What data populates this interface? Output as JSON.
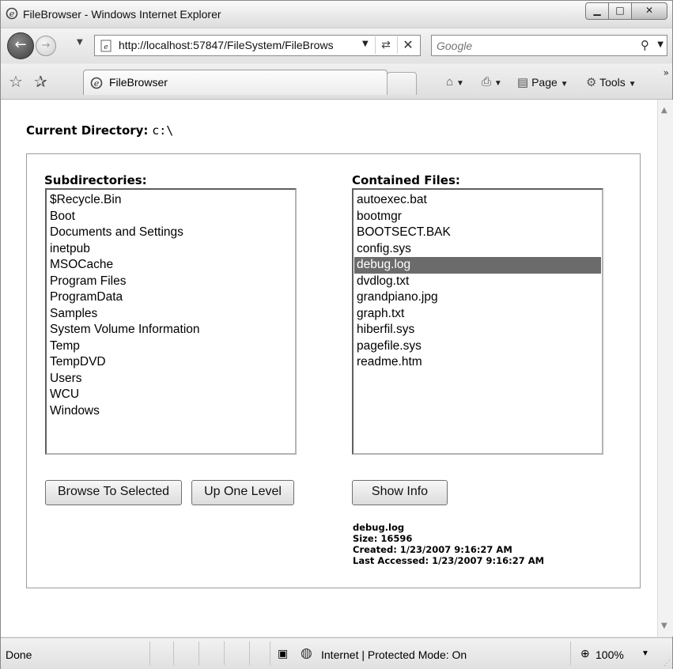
{
  "window": {
    "title": "FileBrowser - Windows Internet Explorer"
  },
  "address_bar": {
    "url": "http://localhost:57847/FileSystem/FileBrows"
  },
  "search": {
    "placeholder": "Google"
  },
  "tab": {
    "label": "FileBrowser"
  },
  "command_bar": {
    "page_label": "Page",
    "tools_label": "Tools"
  },
  "page": {
    "current_dir_label": "Current Directory:",
    "current_dir_value": "c:\\",
    "subdirs_label": "Subdirectories:",
    "files_label": "Contained Files:",
    "subdirectories": [
      "$Recycle.Bin",
      "Boot",
      "Documents and Settings",
      "inetpub",
      "MSOCache",
      "Program Files",
      "ProgramData",
      "Samples",
      "System Volume Information",
      "Temp",
      "TempDVD",
      "Users",
      "WCU",
      "Windows"
    ],
    "files": [
      "autoexec.bat",
      "bootmgr",
      "BOOTSECT.BAK",
      "config.sys",
      "debug.log",
      "dvdlog.txt",
      "grandpiano.jpg",
      "graph.txt",
      "hiberfil.sys",
      "pagefile.sys",
      "readme.htm"
    ],
    "selected_file_index": 4,
    "buttons": {
      "browse": "Browse To Selected",
      "up": "Up One Level",
      "info": "Show Info"
    },
    "file_info": {
      "name": "debug.log",
      "size": "Size: 16596",
      "created": "Created: 1/23/2007 9:16:27 AM",
      "accessed": "Last Accessed: 1/23/2007 9:16:27 AM"
    }
  },
  "status": {
    "text": "Done",
    "zone": "Internet | Protected Mode: On",
    "zoom": "100%"
  },
  "icons": [
    "ie-icon",
    "back-arrow-icon",
    "forward-arrow-icon",
    "page-icon",
    "refresh-icon",
    "stop-icon",
    "search-icon",
    "favorites-star-icon",
    "add-favorites-icon",
    "home-icon",
    "print-icon",
    "page-icon",
    "tools-gear-icon",
    "chevron-icon",
    "lock-icon",
    "globe-icon",
    "zoom-icon"
  ],
  "colors": {
    "selection": "#6b6b6b",
    "chrome": "#e9e9e9"
  }
}
